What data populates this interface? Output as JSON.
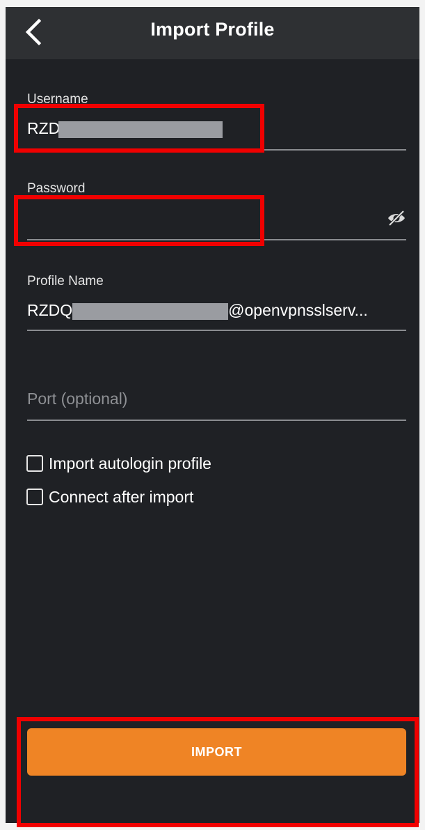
{
  "header": {
    "title": "Import Profile",
    "back_icon": "chevron-left-icon"
  },
  "form": {
    "username": {
      "label": "Username",
      "value_prefix": "RZDQ",
      "redacted": true
    },
    "password": {
      "label": "Password",
      "value": "",
      "toggle_icon": "eye-off-icon"
    },
    "profile_name": {
      "label": "Profile Name",
      "value_prefix": "RZDQ",
      "value_suffix": "@openvpnsslserv...",
      "redacted": true
    },
    "port": {
      "placeholder": "Port (optional)",
      "value": ""
    },
    "checkboxes": [
      {
        "label": "Import autologin profile",
        "checked": false
      },
      {
        "label": "Connect after import",
        "checked": false
      }
    ]
  },
  "actions": {
    "import_label": "IMPORT"
  },
  "colors": {
    "background": "#1f2125",
    "app_bar": "#2e3033",
    "accent": "#ef8425",
    "highlight": "#f00000",
    "redaction": "#9a9ca1"
  }
}
